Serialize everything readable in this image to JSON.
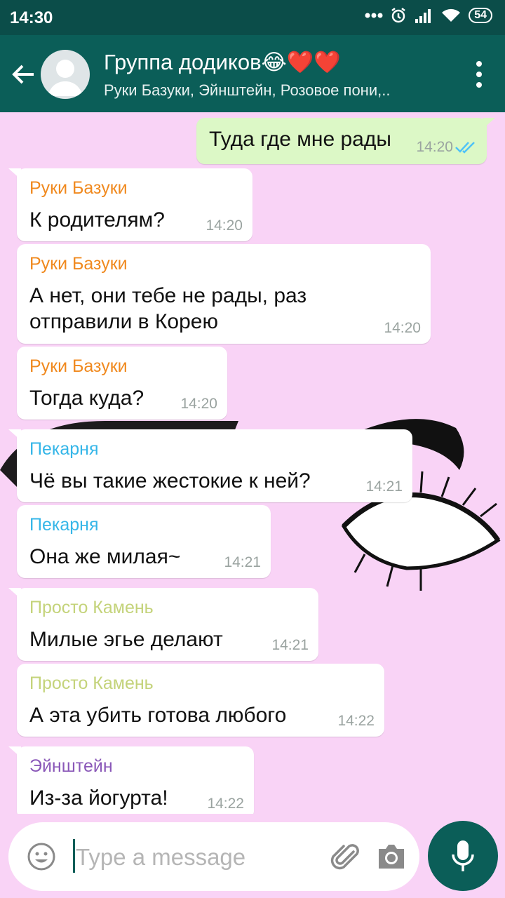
{
  "status_bar": {
    "time": "14:30",
    "battery": "54"
  },
  "header": {
    "title": "Группа додиков😂❤️❤️",
    "subtitle": "Руки Базуки, Эйнштейн, Розовое пони,.."
  },
  "messages": [
    {
      "direction": "out",
      "text": "Туда где мне рады",
      "time": "14:20",
      "status": "read-double-check"
    },
    {
      "direction": "in",
      "sender": "Руки Базуки",
      "sender_color": "#f0891e",
      "text": "К родителям?",
      "time": "14:20"
    },
    {
      "direction": "in",
      "sender": "Руки Базуки",
      "sender_color": "#f0891e",
      "text": "А нет, они тебе не рады, раз отправили в Корею",
      "time": "14:20"
    },
    {
      "direction": "in",
      "sender": "Руки Базуки",
      "sender_color": "#f0891e",
      "text": "Тогда куда?",
      "time": "14:20"
    },
    {
      "direction": "in",
      "sender": "Пекарня",
      "sender_color": "#35b6e8",
      "text": "Чё вы такие жестокие к ней?",
      "time": "14:21"
    },
    {
      "direction": "in",
      "sender": "Пекарня",
      "sender_color": "#35b6e8",
      "text": "Она же милая~",
      "time": "14:21"
    },
    {
      "direction": "in",
      "sender": "Просто Камень",
      "sender_color": "#c4d37a",
      "text": "Милые эгье делают",
      "time": "14:21"
    },
    {
      "direction": "in",
      "sender": "Просто Камень",
      "sender_color": "#c4d37a",
      "text": "А эта убить готова любого",
      "time": "14:22"
    },
    {
      "direction": "in",
      "sender": "Эйнштейн",
      "sender_color": "#8a58b8",
      "text": "Из-за йогурта!",
      "time": "14:22"
    }
  ],
  "composer": {
    "placeholder": "Type a message",
    "value": ""
  },
  "colors": {
    "header": "#0b5e58",
    "status_bar": "#0b4d49",
    "chat_background": "#f9d3f6",
    "outgoing_bubble": "#dcf8c6",
    "read_check": "#4fc3f7"
  },
  "icons": [
    "back-arrow-icon",
    "avatar-icon",
    "more-vert-icon",
    "double-check-icon",
    "emoji-icon",
    "attach-icon",
    "camera-icon",
    "mic-icon"
  ]
}
